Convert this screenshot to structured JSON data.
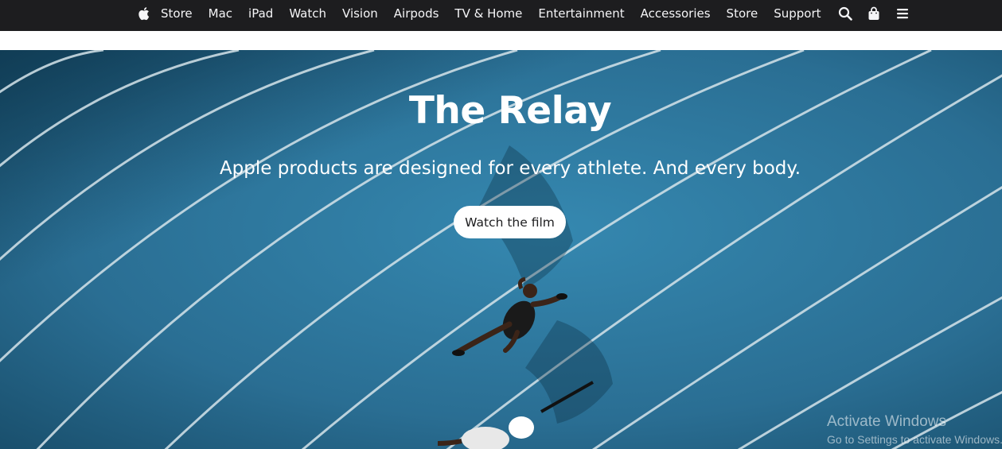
{
  "nav": {
    "logo_icon": "apple-logo-icon",
    "links": [
      "Store",
      "Mac",
      "iPad",
      "Watch",
      "Vision",
      "Airpods",
      "TV & Home",
      "Entertainment",
      "Accessories",
      "Store",
      "Support"
    ],
    "icons": [
      "search-icon",
      "bag-icon",
      "menu-icon"
    ],
    "background": "#1d1d1f",
    "text_color": "#f5f5f7"
  },
  "hero": {
    "title": "The Relay",
    "subtitle": "Apple products are designed for every athlete. And every body.",
    "cta_label": "Watch the film",
    "track_color": "#2a6f95"
  },
  "watermark": {
    "title": "Activate Windows",
    "subtitle": "Go to Settings to activate Windows."
  }
}
